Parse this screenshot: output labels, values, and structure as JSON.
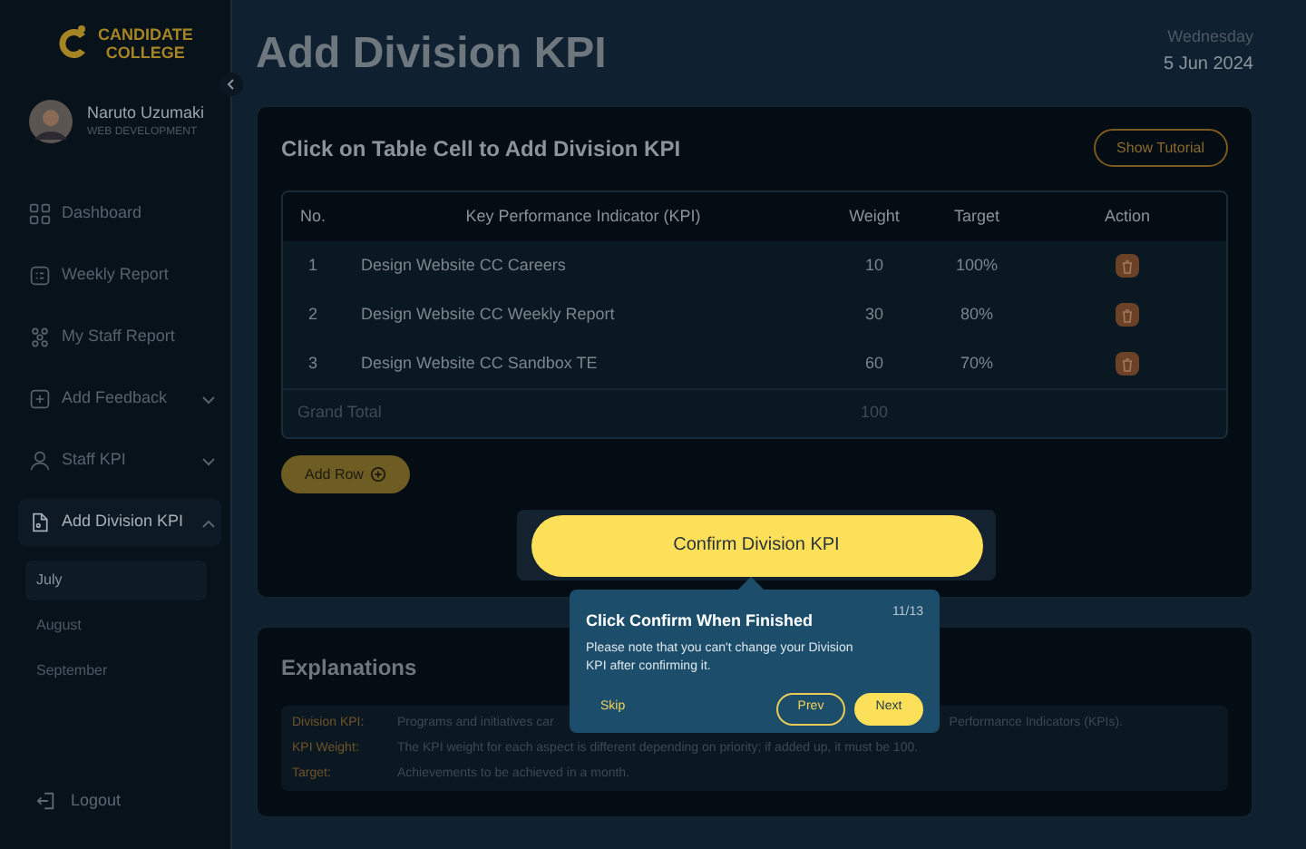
{
  "brand": {
    "line1": "CANDIDATE",
    "line2": "COLLEGE"
  },
  "user": {
    "name": "Naruto Uzumaki",
    "role": "WEB DEVELOPMENT"
  },
  "sidebar": {
    "items": [
      {
        "label": "Dashboard",
        "selected": false
      },
      {
        "label": "Weekly Report",
        "selected": false
      },
      {
        "label": "My Staff Report",
        "selected": false
      },
      {
        "label": "Add Feedback",
        "selected": false,
        "expanded": false
      },
      {
        "label": "Staff KPI",
        "selected": false,
        "expanded": false
      },
      {
        "label": "Add Division KPI",
        "selected": true,
        "expanded": true,
        "children": [
          {
            "label": "July",
            "selected": true
          },
          {
            "label": "August",
            "selected": false
          },
          {
            "label": "September",
            "selected": false
          }
        ]
      }
    ],
    "logout": "Logout"
  },
  "page": {
    "title": "Add Division KPI",
    "weekday": "Wednesday",
    "date": "5 Jun 2024"
  },
  "kpi_card": {
    "title": "Click on Table Cell to Add Division KPI",
    "tutorial_button": "Show Tutorial",
    "table": {
      "columns": [
        "No.",
        "Key Performance Indicator (KPI)",
        "Weight",
        "Target",
        "Action"
      ],
      "rows": [
        {
          "no": "1",
          "kpi": "Design Website CC Careers",
          "weight": "10",
          "target": "100%"
        },
        {
          "no": "2",
          "kpi": "Design Website CC Weekly Report",
          "weight": "30",
          "target": "80%"
        },
        {
          "no": "3",
          "kpi": "Design Website CC Sandbox TE",
          "weight": "60",
          "target": "70%"
        }
      ],
      "total": {
        "label": "Grand Total",
        "weight": "100"
      }
    },
    "add_row": "Add Row",
    "confirm": "Confirm Division KPI"
  },
  "explanations": {
    "title": "Explanations",
    "items": [
      {
        "term": "Division KPI:",
        "text_start": "Programs and initiatives car",
        "text_end": "Performance Indicators (KPIs)."
      },
      {
        "term": "KPI Weight:",
        "text_start": "The KPI weight for each aspect is different depending on priority; if added up, it must be 100."
      },
      {
        "term": "Target:",
        "text_start": "Achievements to be achieved in a month."
      }
    ]
  },
  "tour": {
    "title": "Click Confirm When Finished",
    "step": "11/13",
    "body": "Please note that you can't change your Division KPI after confirming it.",
    "skip": "Skip",
    "prev": "Prev",
    "next": "Next"
  }
}
